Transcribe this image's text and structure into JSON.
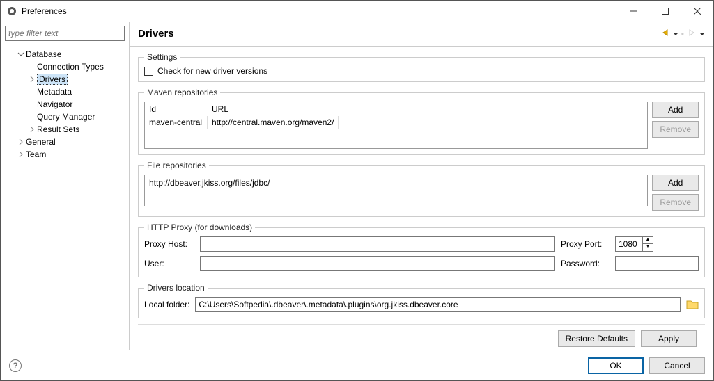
{
  "window": {
    "title": "Preferences"
  },
  "filter": {
    "placeholder": "type filter text"
  },
  "tree": {
    "database": "Database",
    "connection_types": "Connection Types",
    "drivers": "Drivers",
    "metadata": "Metadata",
    "navigator": "Navigator",
    "query_manager": "Query Manager",
    "result_sets": "Result Sets",
    "general": "General",
    "team": "Team"
  },
  "header": {
    "title": "Drivers"
  },
  "settings": {
    "legend": "Settings",
    "check_new_versions": "Check for new driver versions"
  },
  "maven": {
    "legend": "Maven repositories",
    "col_id": "Id",
    "col_url": "URL",
    "rows": [
      {
        "id": "maven-central",
        "url": "http://central.maven.org/maven2/"
      }
    ],
    "add": "Add",
    "remove": "Remove"
  },
  "files": {
    "legend": "File repositories",
    "rows": [
      "http://dbeaver.jkiss.org/files/jdbc/"
    ],
    "add": "Add",
    "remove": "Remove"
  },
  "proxy": {
    "legend": "HTTP Proxy (for downloads)",
    "host_label": "Proxy Host:",
    "port_label": "Proxy Port:",
    "port_value": "1080",
    "user_label": "User:",
    "password_label": "Password:"
  },
  "location": {
    "legend": "Drivers location",
    "label": "Local folder:",
    "value": "C:\\Users\\Softpedia\\.dbeaver\\.metadata\\.plugins\\org.jkiss.dbeaver.core"
  },
  "buttons": {
    "restore": "Restore Defaults",
    "apply": "Apply",
    "ok": "OK",
    "cancel": "Cancel"
  }
}
